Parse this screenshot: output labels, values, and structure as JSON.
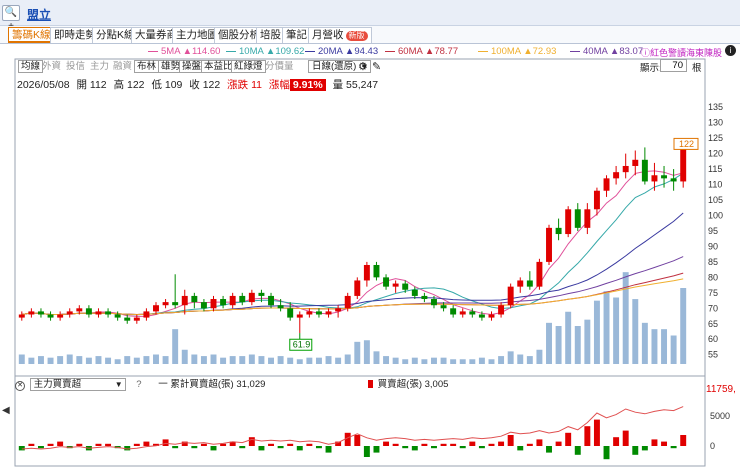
{
  "topbar": {
    "search_icon": "🔍+",
    "stock_name": "盟立"
  },
  "tabs": [
    {
      "label": "籌碼K線",
      "active": true
    },
    {
      "label": "即時走勢"
    },
    {
      "label": "分點K線"
    },
    {
      "label": "大量券商"
    },
    {
      "label": "主力地圖"
    },
    {
      "label": "個股分析"
    },
    {
      "label": "培股"
    },
    {
      "label": "筆記"
    },
    {
      "label": "月營收",
      "badge": "新版"
    }
  ],
  "ma_legend": [
    {
      "label": "5MA ▲114.60",
      "color": "#e0509a"
    },
    {
      "label": "10MA ▲109.62",
      "color": "#36a9a9"
    },
    {
      "label": "20MA ▲94.43",
      "color": "#3a3aa0"
    },
    {
      "label": "60MA ▲78.77",
      "color": "#c03040"
    },
    {
      "label": "100MA ▲72.93",
      "color": "#f0b030"
    },
    {
      "label": "40MA ▲83.07",
      "color": "#7040a0"
    }
  ],
  "ma_note": "ⓘ紅色警讀海東陳股",
  "toolbar": {
    "items": [
      {
        "label": "均線",
        "dim": false
      },
      {
        "label": "外資",
        "dim": true
      },
      {
        "label": "投信",
        "dim": true
      },
      {
        "label": "主力",
        "dim": true
      },
      {
        "label": "融資",
        "dim": true
      },
      {
        "label": "布林",
        "dim": false
      },
      {
        "label": "雄勢",
        "dim": false
      },
      {
        "label": "操盤",
        "dim": false
      },
      {
        "label": "本益比",
        "dim": false
      },
      {
        "label": "紅綠燈",
        "dim": false
      },
      {
        "label": "分價量",
        "dim": true
      }
    ],
    "period": "日線(還原)",
    "zoom_label": "顯示:",
    "zoom_value": "70",
    "zoom_unit": "根"
  },
  "quote": {
    "date": "2026/05/08",
    "open": "開 112",
    "high": "高 122",
    "low": "低 109",
    "close": "收 122",
    "change": "漲跌 11",
    "pct_label": "漲幅",
    "pct_value": "9.91%",
    "volume": "量 55,247"
  },
  "price_axis": [
    "135",
    "130",
    "125",
    "120",
    "115",
    "110",
    "105",
    "100",
    "95",
    "90",
    "85",
    "80",
    "75",
    "70",
    "65",
    "60",
    "55"
  ],
  "last_price_tag": "122",
  "low_tag": "61.9",
  "sub": {
    "selector": "主力買賣超",
    "help": "?",
    "legend1": "一 累計買賣超(張) 31,029",
    "legend2": "買賣超(張) 3,005",
    "right_value": "11759,",
    "axis": [
      "5000",
      "0"
    ]
  },
  "chart_data": {
    "type": "candlestick",
    "ylim": [
      52,
      137
    ],
    "candles": [
      [
        67,
        69,
        66,
        68
      ],
      [
        68,
        70,
        67,
        69
      ],
      [
        69,
        70,
        67,
        68
      ],
      [
        68,
        69,
        66,
        67
      ],
      [
        67,
        69,
        66,
        68
      ],
      [
        68,
        70,
        67,
        69
      ],
      [
        69,
        71,
        68,
        70
      ],
      [
        70,
        71,
        67,
        68
      ],
      [
        68,
        70,
        67,
        69
      ],
      [
        69,
        70,
        67,
        68
      ],
      [
        68,
        69,
        66,
        67
      ],
      [
        67,
        68,
        65,
        66
      ],
      [
        66,
        68,
        65,
        67
      ],
      [
        67,
        70,
        66,
        69
      ],
      [
        69,
        72,
        68,
        71
      ],
      [
        71,
        73,
        70,
        72
      ],
      [
        72,
        81,
        70,
        71
      ],
      [
        71,
        76,
        68,
        74
      ],
      [
        74,
        75,
        70,
        72
      ],
      [
        72,
        73,
        69,
        70
      ],
      [
        70,
        74,
        69,
        73
      ],
      [
        73,
        74,
        70,
        71
      ],
      [
        71,
        75,
        70,
        74
      ],
      [
        74,
        75,
        71,
        72
      ],
      [
        72,
        76,
        71,
        75
      ],
      [
        75,
        76,
        72,
        74
      ],
      [
        74,
        75,
        70,
        71
      ],
      [
        71,
        73,
        69,
        70
      ],
      [
        70,
        72,
        66,
        67
      ],
      [
        67,
        69,
        62,
        68
      ],
      [
        68,
        70,
        67,
        69
      ],
      [
        69,
        70,
        67,
        68
      ],
      [
        68,
        70,
        67,
        69
      ],
      [
        69,
        71,
        67,
        70
      ],
      [
        70,
        75,
        69,
        74
      ],
      [
        74,
        80,
        73,
        79
      ],
      [
        79,
        85,
        77,
        84
      ],
      [
        84,
        85,
        79,
        80
      ],
      [
        80,
        81,
        76,
        77
      ],
      [
        77,
        79,
        75,
        78
      ],
      [
        78,
        79,
        75,
        76
      ],
      [
        76,
        77,
        73,
        74
      ],
      [
        74,
        75,
        72,
        73
      ],
      [
        73,
        74,
        70,
        71
      ],
      [
        71,
        72,
        69,
        70
      ],
      [
        70,
        71,
        67,
        68
      ],
      [
        68,
        70,
        67,
        69
      ],
      [
        69,
        70,
        67,
        68
      ],
      [
        68,
        69,
        66,
        67
      ],
      [
        67,
        69,
        66,
        68
      ],
      [
        68,
        72,
        67,
        71
      ],
      [
        71,
        78,
        70,
        77
      ],
      [
        77,
        80,
        75,
        79
      ],
      [
        79,
        82,
        76,
        77
      ],
      [
        77,
        86,
        76,
        85
      ],
      [
        85,
        97,
        84,
        96
      ],
      [
        96,
        99,
        92,
        94
      ],
      [
        94,
        103,
        93,
        102
      ],
      [
        102,
        104,
        95,
        96
      ],
      [
        96,
        104,
        94,
        102
      ],
      [
        102,
        109,
        100,
        108
      ],
      [
        108,
        113,
        106,
        112
      ],
      [
        112,
        116,
        110,
        114
      ],
      [
        114,
        120,
        112,
        116
      ],
      [
        116,
        121,
        113,
        118
      ],
      [
        118,
        122,
        110,
        111
      ],
      [
        111,
        117,
        108,
        113
      ],
      [
        113,
        116,
        109,
        112
      ],
      [
        112,
        115,
        108,
        111
      ],
      [
        111,
        122,
        109,
        122
      ]
    ],
    "volumes": [
      6,
      4,
      5,
      4,
      5,
      6,
      5,
      4,
      5,
      4,
      3,
      5,
      4,
      5,
      6,
      5,
      22,
      9,
      6,
      5,
      6,
      4,
      5,
      5,
      6,
      5,
      4,
      5,
      4,
      3,
      4,
      4,
      5,
      4,
      6,
      14,
      15,
      8,
      5,
      4,
      3,
      4,
      3,
      4,
      4,
      3,
      3,
      3,
      4,
      3,
      5,
      8,
      6,
      5,
      9,
      26,
      24,
      33,
      24,
      28,
      40,
      46,
      42,
      58,
      41,
      26,
      22,
      22,
      18,
      48
    ],
    "vol_max": 60,
    "net_buy": [
      -2,
      1,
      -1,
      1,
      2,
      -1,
      1,
      -2,
      1,
      1,
      -1,
      -2,
      1,
      2,
      1,
      3,
      -1,
      2,
      -1,
      1,
      -2,
      1,
      2,
      -1,
      4,
      -2,
      1,
      -1,
      1,
      -2,
      1,
      -1,
      -3,
      2,
      6,
      5,
      -5,
      -3,
      2,
      1,
      -1,
      -2,
      1,
      -1,
      1,
      1,
      -1,
      2,
      -1,
      1,
      2,
      5,
      -2,
      1,
      3,
      -3,
      2,
      6,
      -4,
      9,
      12,
      -6,
      4,
      7,
      -4,
      -2,
      3,
      2,
      -1,
      5
    ],
    "net_buy_cum": [
      0,
      1,
      0,
      1,
      3,
      2,
      3,
      1,
      2,
      3,
      2,
      0,
      1,
      3,
      4,
      7,
      6,
      8,
      7,
      8,
      6,
      7,
      9,
      8,
      12,
      10,
      11,
      10,
      11,
      9,
      10,
      9,
      6,
      8,
      14,
      19,
      14,
      11,
      13,
      14,
      13,
      11,
      12,
      11,
      12,
      13,
      12,
      14,
      13,
      14,
      16,
      21,
      19,
      20,
      23,
      20,
      22,
      28,
      24,
      33,
      45,
      39,
      43,
      50,
      46,
      44,
      47,
      49,
      48,
      53
    ]
  }
}
